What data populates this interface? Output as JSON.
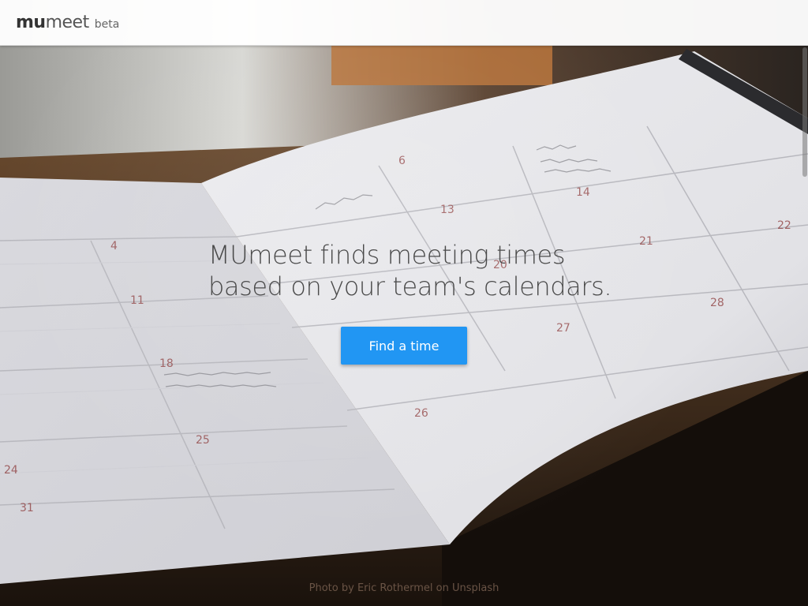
{
  "header": {
    "logo_bold": "mu",
    "logo_light": "meet",
    "logo_badge": "beta"
  },
  "hero": {
    "headline_line1": "MUmeet finds meeting times",
    "headline_line2": "based on your team's calendars.",
    "cta_label": "Find a time",
    "background_icon": "calendar-planner-photo"
  },
  "footer": {
    "credit_prefix": "Photo by ",
    "credit_author": "Eric Rothermel",
    "credit_middle": " on ",
    "credit_site": "Unsplash"
  },
  "colors": {
    "accent": "#2196f3",
    "header_bg": "#ffffff",
    "headline_text": "#4a4a4a"
  }
}
